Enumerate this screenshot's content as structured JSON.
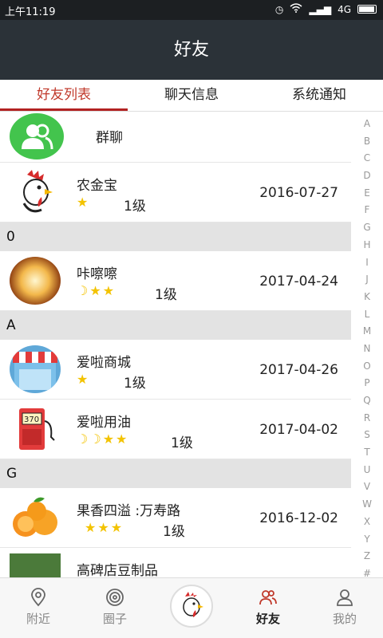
{
  "status_bar": {
    "time": "上午11:19",
    "signal": "4G"
  },
  "header": {
    "title": "好友"
  },
  "tabs": [
    {
      "label": "好友列表",
      "active": true
    },
    {
      "label": "聊天信息",
      "active": false
    },
    {
      "label": "系统通知",
      "active": false
    }
  ],
  "group_chat": {
    "label": "群聊"
  },
  "sections": [
    {
      "header": "",
      "friends": [
        {
          "name": "农金宝",
          "stars": "★",
          "level": "1级",
          "date": "2016-07-27"
        }
      ]
    },
    {
      "header": "0",
      "friends": [
        {
          "name": "咔嚓嚓",
          "stars": "☽★★",
          "level": "1级",
          "date": "2017-04-24"
        }
      ]
    },
    {
      "header": "A",
      "friends": [
        {
          "name": "爱啦商城",
          "stars": "★",
          "level": "1级",
          "date": "2017-04-26"
        },
        {
          "name": "爱啦用油",
          "stars": "☽☽★★",
          "level": "1级",
          "date": "2017-04-02"
        }
      ]
    },
    {
      "header": "G",
      "friends": [
        {
          "name": "果香四溢 :万寿路",
          "stars": "★★★",
          "level": "1级",
          "date": "2016-12-02"
        },
        {
          "name": "高碑店豆制品",
          "stars": "",
          "level": "",
          "date": ""
        }
      ]
    }
  ],
  "alphabet": [
    "A",
    "B",
    "C",
    "D",
    "E",
    "F",
    "G",
    "H",
    "I",
    "J",
    "K",
    "L",
    "M",
    "N",
    "O",
    "P",
    "Q",
    "R",
    "S",
    "T",
    "U",
    "V",
    "W",
    "X",
    "Y",
    "Z",
    "#"
  ],
  "bottom_nav": [
    {
      "label": "附近",
      "icon": "location-pin-icon"
    },
    {
      "label": "圈子",
      "icon": "target-circle-icon"
    },
    {
      "label": "",
      "icon": "rooster-logo-icon"
    },
    {
      "label": "好友",
      "icon": "friends-icon",
      "active": true
    },
    {
      "label": "我的",
      "icon": "person-icon"
    }
  ],
  "colors": {
    "accent": "#c0392b",
    "header_bg": "#2b3238",
    "group_green": "#43c44d",
    "star": "#f3c300"
  }
}
